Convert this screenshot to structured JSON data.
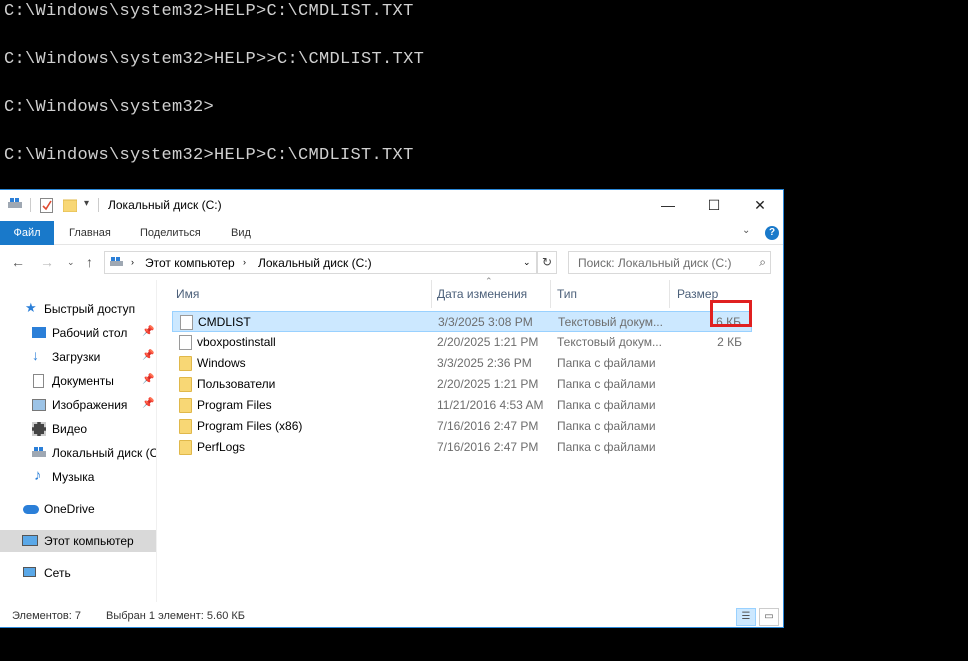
{
  "console": {
    "lines": [
      "C:\\Windows\\system32>HELP>C:\\CMDLIST.TXT",
      "C:\\Windows\\system32>HELP>>C:\\CMDLIST.TXT",
      "C:\\Windows\\system32>",
      "C:\\Windows\\system32>HELP>C:\\CMDLIST.TXT"
    ]
  },
  "window": {
    "title": "Локальный диск (C:)",
    "minimize_glyph": "—",
    "maximize_glyph": "☐",
    "close_glyph": "✕"
  },
  "ribbon": {
    "tabs": [
      "Файл",
      "Главная",
      "Поделиться",
      "Вид"
    ],
    "help": "?"
  },
  "address": {
    "crumbs": [
      "Этот компьютер",
      "Локальный диск (C:)"
    ],
    "search_placeholder": "Поиск: Локальный диск (C:)"
  },
  "sidebar": {
    "items": [
      {
        "label": "Быстрый доступ",
        "icon": "star-icon",
        "pinned": false
      },
      {
        "label": "Рабочий стол",
        "icon": "desktop-icon",
        "pinned": true
      },
      {
        "label": "Загрузки",
        "icon": "download-icon",
        "pinned": true
      },
      {
        "label": "Документы",
        "icon": "documents-icon",
        "pinned": true
      },
      {
        "label": "Изображения",
        "icon": "pictures-icon",
        "pinned": true
      },
      {
        "label": "Видео",
        "icon": "video-icon",
        "pinned": false
      },
      {
        "label": "Локальный диск (C",
        "icon": "drive-icon",
        "pinned": false
      },
      {
        "label": "Музыка",
        "icon": "music-icon",
        "pinned": false
      },
      {
        "label": "OneDrive",
        "icon": "cloud-icon",
        "pinned": false
      },
      {
        "label": "Этот компьютер",
        "icon": "computer-icon",
        "pinned": false,
        "selected": true
      },
      {
        "label": "Сеть",
        "icon": "network-icon",
        "pinned": false
      }
    ]
  },
  "columns": [
    "Имя",
    "Дата изменения",
    "Тип",
    "Размер"
  ],
  "files": [
    {
      "name": "CMDLIST",
      "date": "3/3/2025 3:08 PM",
      "type": "Текстовый докум...",
      "size": "6 КБ",
      "kind": "file",
      "selected": true
    },
    {
      "name": "vboxpostinstall",
      "date": "2/20/2025 1:21 PM",
      "type": "Текстовый докум...",
      "size": "2 КБ",
      "kind": "file"
    },
    {
      "name": "Windows",
      "date": "3/3/2025 2:36 PM",
      "type": "Папка с файлами",
      "size": "",
      "kind": "folder"
    },
    {
      "name": "Пользователи",
      "date": "2/20/2025 1:21 PM",
      "type": "Папка с файлами",
      "size": "",
      "kind": "folder"
    },
    {
      "name": "Program Files",
      "date": "11/21/2016 4:53 AM",
      "type": "Папка с файлами",
      "size": "",
      "kind": "folder"
    },
    {
      "name": "Program Files (x86)",
      "date": "7/16/2016 2:47 PM",
      "type": "Папка с файлами",
      "size": "",
      "kind": "folder"
    },
    {
      "name": "PerfLogs",
      "date": "7/16/2016 2:47 PM",
      "type": "Папка с файлами",
      "size": "",
      "kind": "folder"
    }
  ],
  "status": {
    "count": "Элементов: 7",
    "selection": "Выбран 1 элемент: 5.60 КБ"
  },
  "colors": {
    "accent": "#1979ca",
    "selection_bg": "#cce8ff",
    "highlight": "#e02020"
  }
}
